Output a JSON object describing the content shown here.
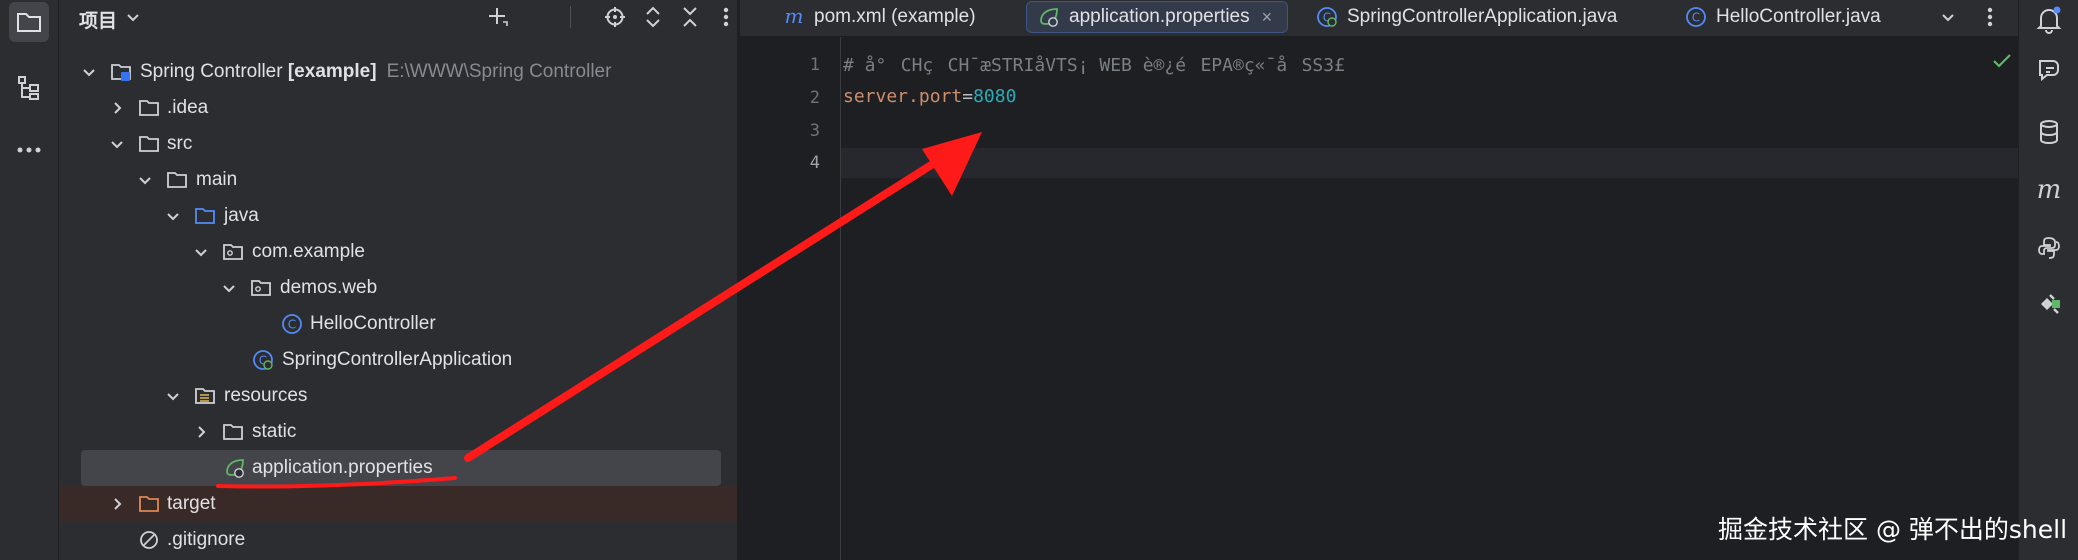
{
  "project_panel": {
    "title": "项目",
    "tree": [
      {
        "label": "Spring Controller",
        "bold_suffix": " [example]",
        "path": "E:\\WWW\\Spring Controller",
        "icon": "module-folder-icon"
      },
      {
        "label": ".idea",
        "icon": "folder-icon"
      },
      {
        "label": "src",
        "icon": "folder-icon"
      },
      {
        "label": "main",
        "icon": "folder-icon"
      },
      {
        "label": "java",
        "icon": "source-folder-icon"
      },
      {
        "label": "com.example",
        "icon": "package-icon"
      },
      {
        "label": "demos.web",
        "icon": "package-icon"
      },
      {
        "label": "HelloController",
        "icon": "class-icon"
      },
      {
        "label": "SpringControllerApplication",
        "icon": "spring-boot-class-icon"
      },
      {
        "label": "resources",
        "icon": "resources-folder-icon"
      },
      {
        "label": "static",
        "icon": "folder-icon"
      },
      {
        "label": "application.properties",
        "icon": "spring-properties-icon"
      },
      {
        "label": "target",
        "icon": "excluded-folder-icon"
      },
      {
        "label": ".gitignore",
        "icon": "gitignore-icon"
      }
    ]
  },
  "tabs": [
    {
      "label": "pom.xml (example)",
      "icon": "maven-icon"
    },
    {
      "label": "application.properties",
      "icon": "spring-properties-icon",
      "close": "×"
    },
    {
      "label": "SpringControllerApplication.java",
      "icon": "spring-boot-class-icon"
    },
    {
      "label": "HelloController.java",
      "icon": "class-icon"
    }
  ],
  "editor": {
    "line_numbers": [
      "1",
      "2",
      "3",
      "4"
    ],
    "lines": {
      "comment": "# å°CHçCH¯æSTRIåVTS¡ WEB è®¿éEPA®ç«¯åSS3£",
      "key": "server.port",
      "eq": "=",
      "value": "8080"
    }
  },
  "watermark": "掘金技术社区 @ 弹不出的shell",
  "colors": {
    "annotation_arrow": "#ff1a1a",
    "selection": "#43454a",
    "active_tab_border": "#3e5588"
  }
}
